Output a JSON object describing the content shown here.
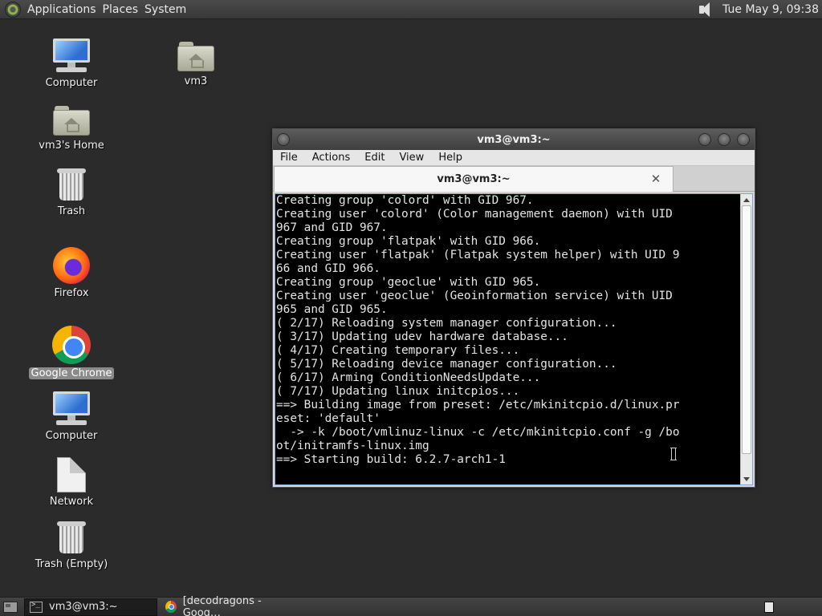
{
  "top_panel": {
    "menus": [
      "Applications",
      "Places",
      "System"
    ],
    "clock": "Tue May  9, 09:38"
  },
  "desktop_icons": [
    {
      "label": "Computer",
      "icon": "computer-icon"
    },
    {
      "label": "vm3's Home",
      "icon": "home-folder-icon"
    },
    {
      "label": "Trash",
      "icon": "trash-icon"
    },
    {
      "label": "Firefox",
      "icon": "firefox-icon"
    },
    {
      "label": "Google Chrome",
      "icon": "chrome-icon"
    },
    {
      "label": "Computer",
      "icon": "computer-icon"
    },
    {
      "label": "Network",
      "icon": "document-icon"
    },
    {
      "label": "Trash (Empty)",
      "icon": "trash-icon"
    },
    {
      "label": "vm3",
      "icon": "home-folder-icon"
    }
  ],
  "terminal": {
    "window_title": "vm3@vm3:~",
    "menu": [
      "File",
      "Actions",
      "Edit",
      "View",
      "Help"
    ],
    "tab_title": "vm3@vm3:~",
    "lines": [
      "Creating group 'colord' with GID 967.",
      "Creating user 'colord' (Color management daemon) with UID",
      "967 and GID 967.",
      "Creating group 'flatpak' with GID 966.",
      "Creating user 'flatpak' (Flatpak system helper) with UID 9",
      "66 and GID 966.",
      "Creating group 'geoclue' with GID 965.",
      "Creating user 'geoclue' (Geoinformation service) with UID",
      "965 and GID 965.",
      "( 2/17) Reloading system manager configuration...",
      "( 3/17) Updating udev hardware database...",
      "( 4/17) Creating temporary files...",
      "( 5/17) Reloading device manager configuration...",
      "( 6/17) Arming ConditionNeedsUpdate...",
      "( 7/17) Updating linux initcpios...",
      "==> Building image from preset: /etc/mkinitcpio.d/linux.pr",
      "eset: 'default'",
      "  -> -k /boot/vmlinuz-linux -c /etc/mkinitcpio.conf -g /bo",
      "ot/initramfs-linux.img",
      "==> Starting build: 6.2.7-arch1-1"
    ]
  },
  "taskbar": {
    "tasks": [
      {
        "label": "vm3@vm3:~",
        "icon": "terminal-icon"
      },
      {
        "label": "[decodragons - Goog…",
        "icon": "chrome-icon"
      }
    ]
  }
}
